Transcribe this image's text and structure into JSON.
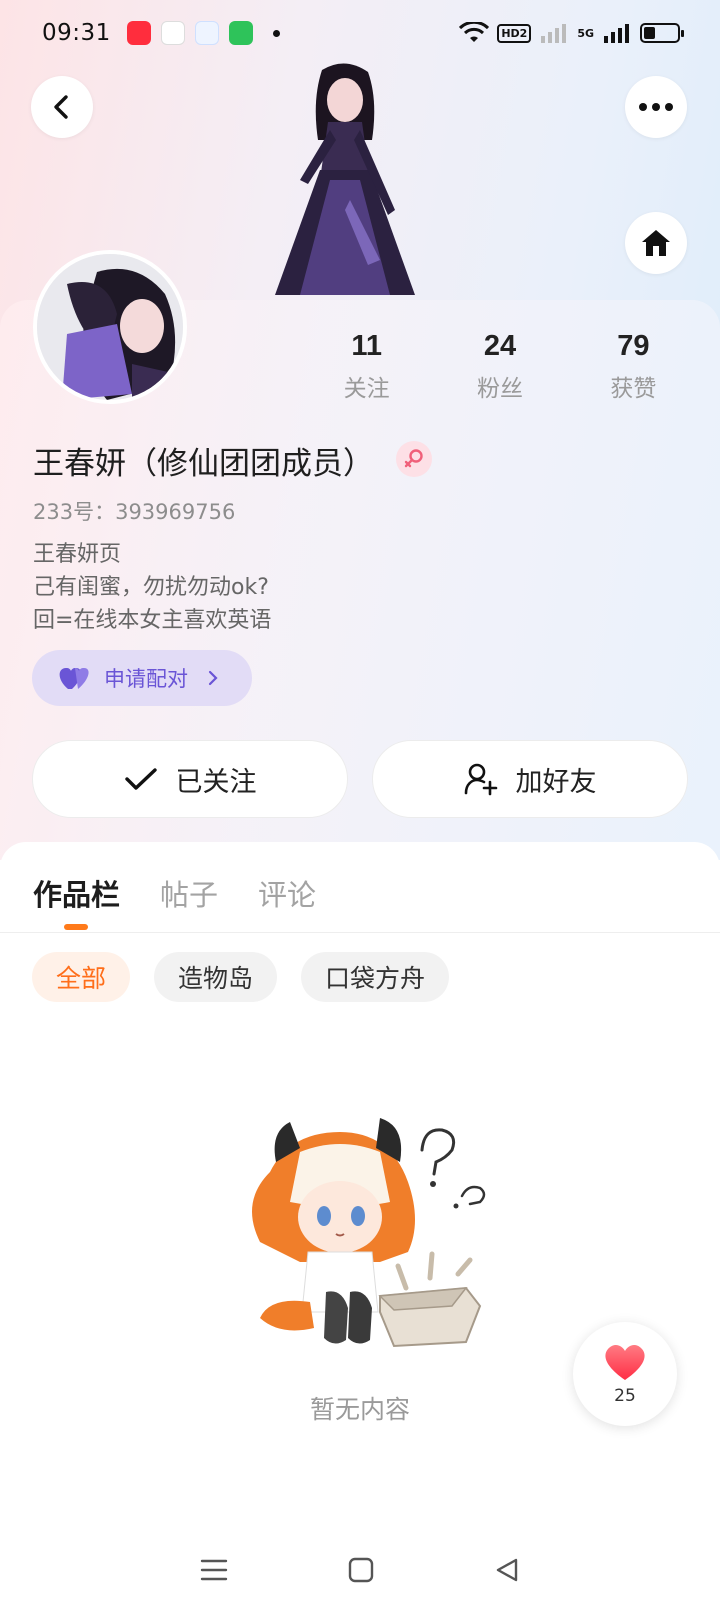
{
  "status_bar": {
    "time": "09:31",
    "network_badge": "HD2",
    "signal_label": "5G",
    "battery_level": 0.35
  },
  "header": {
    "back_icon": "chevron-left-icon",
    "more_icon": "more-dots-icon",
    "home_icon": "home-icon"
  },
  "profile": {
    "stats": [
      {
        "value": "11",
        "label": "关注"
      },
      {
        "value": "24",
        "label": "粉丝"
      },
      {
        "value": "79",
        "label": "获赞"
      }
    ],
    "name": "王春妍（修仙团团成员）",
    "gender_icon": "female-icon",
    "uid": "233号：393969756",
    "bio": [
      "王春妍页",
      "己有闺蜜，勿扰勿动ok?",
      "回=在线本女主喜欢英语"
    ],
    "pair_button": "申请配对",
    "followed_button": "已关注",
    "add_friend_button": "加好友"
  },
  "tabs": [
    {
      "label": "作品栏",
      "active": true
    },
    {
      "label": "帖子",
      "active": false
    },
    {
      "label": "评论",
      "active": false
    }
  ],
  "filters": [
    {
      "label": "全部",
      "active": true
    },
    {
      "label": "造物岛",
      "active": false
    },
    {
      "label": "口袋方舟",
      "active": false
    }
  ],
  "empty_state": {
    "text": "暂无内容"
  },
  "like_float": {
    "count": "25"
  },
  "colors": {
    "accent": "#ff7a1a",
    "pair_purple": "#6a55d6",
    "heart_red": "#ff3b4a"
  }
}
